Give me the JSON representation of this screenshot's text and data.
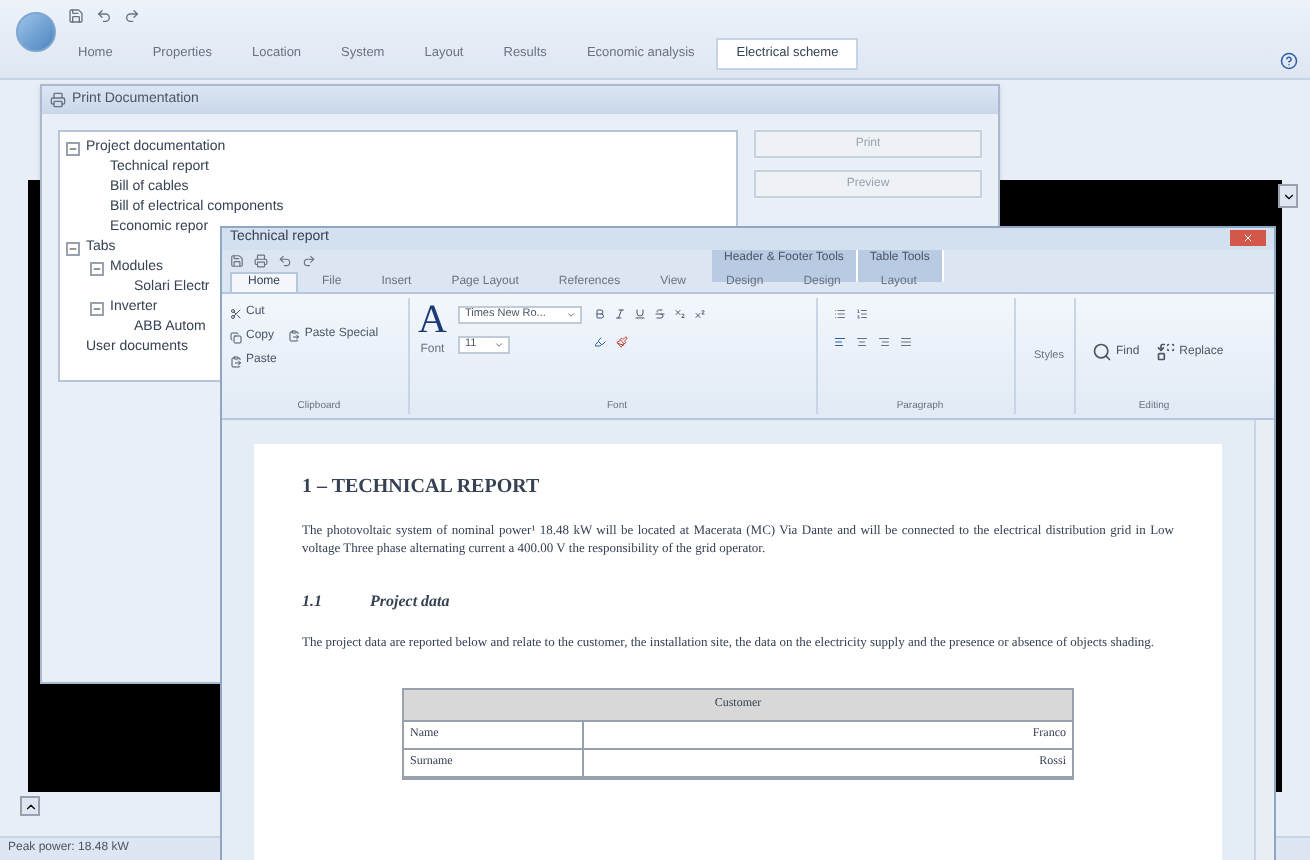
{
  "app": {
    "tabs": [
      {
        "label": "Home",
        "selected": false
      },
      {
        "label": "Properties",
        "selected": false
      },
      {
        "label": "Location",
        "selected": false
      },
      {
        "label": "System",
        "selected": false
      },
      {
        "label": "Layout",
        "selected": false
      },
      {
        "label": "Results",
        "selected": false
      },
      {
        "label": "Economic analysis",
        "selected": false
      },
      {
        "label": "Electrical scheme",
        "selected": true
      }
    ],
    "status_bar": "Peak power: 18.48 kW"
  },
  "dialog": {
    "title": "Print Documentation",
    "tree": [
      {
        "label": "Project documentation",
        "expanded": true,
        "children": [
          {
            "label": "Technical report"
          },
          {
            "label": "Bill of cables"
          },
          {
            "label": "Bill of electrical components"
          },
          {
            "label": "Economic repor"
          }
        ]
      },
      {
        "label": "Tabs",
        "expanded": true,
        "children": [
          {
            "label": "Modules",
            "expanded": true,
            "children": [
              {
                "label": "Solari Electr"
              }
            ]
          },
          {
            "label": "Inverter",
            "expanded": true,
            "children": [
              {
                "label": "ABB Autom"
              }
            ]
          }
        ]
      },
      {
        "label": "User documents"
      }
    ],
    "buttons": [
      "Print",
      "Preview"
    ]
  },
  "word": {
    "title": "Technical report",
    "context_tabs": [
      "Header & Footer Tools",
      "Table Tools"
    ],
    "tabs": [
      {
        "label": "Home",
        "selected": true
      },
      {
        "label": "File",
        "selected": false
      },
      {
        "label": "Insert",
        "selected": false
      },
      {
        "label": "Page Layout",
        "selected": false
      },
      {
        "label": "References",
        "selected": false
      },
      {
        "label": "View",
        "selected": false
      },
      {
        "label": "Design",
        "selected": false
      },
      {
        "label": "Design",
        "selected": false
      },
      {
        "label": "Layout",
        "selected": false
      }
    ],
    "clipboard": {
      "cut": "Cut",
      "copy": "Copy",
      "paste": "Paste",
      "paste_special": "Paste Special",
      "label": "Clipboard"
    },
    "font": {
      "letter": "A",
      "button": "Font",
      "font_name": "Times New Ro...",
      "font_size": "11",
      "label": "Font"
    },
    "paragraph": {
      "label": "Paragraph"
    },
    "styles": "Styles",
    "editing": {
      "find": "Find",
      "replace": "Replace",
      "label": "Editing"
    },
    "document": {
      "heading": "1 – TECHNICAL REPORT",
      "paragraph_1": "The photovoltaic system of nominal power¹ 18.48 kW will be located at Macerata (MC) Via Dante and will be connected to the electrical distribution grid in Low voltage Three phase alternating current a 400.00  V the responsibility of the grid operator.",
      "subheading_number": "1.1",
      "subheading": "Project data",
      "paragraph_2": "The project data are reported below and relate to the customer, the installation site, the data on the electricity supply and the presence or absence of objects shading.",
      "table": {
        "title": "Customer",
        "rows": [
          [
            "Name",
            "Franco"
          ],
          [
            "Surname",
            "Rossi"
          ]
        ]
      }
    }
  }
}
